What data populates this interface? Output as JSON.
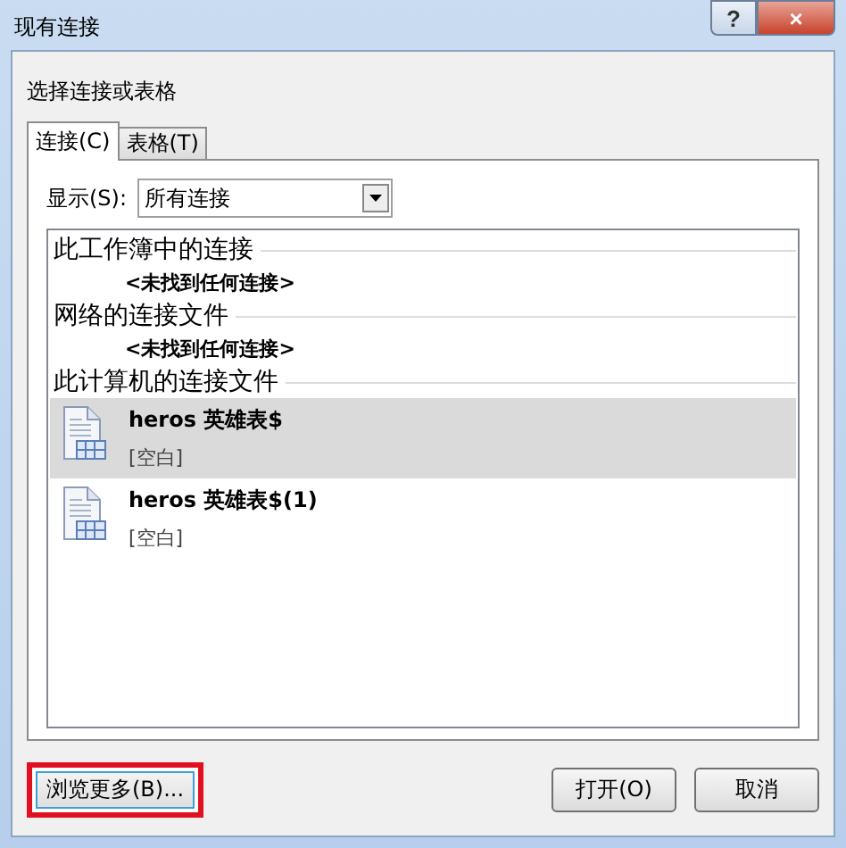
{
  "window": {
    "title": "现有连接",
    "help": "?",
    "close": "×"
  },
  "prompt": "选择连接或表格",
  "tabs": [
    {
      "label": "连接(C)",
      "selected": true
    },
    {
      "label": "表格(T)",
      "selected": false
    }
  ],
  "show": {
    "label": "显示(S):",
    "value": "所有连接"
  },
  "groups": [
    {
      "title": "此工作簿中的连接",
      "empty": "<未找到任何连接>"
    },
    {
      "title": "网络的连接文件",
      "empty": "<未找到任何连接>"
    },
    {
      "title": "此计算机的连接文件",
      "items": [
        {
          "name": "heros 英雄表$",
          "desc": "[空白]",
          "selected": true
        },
        {
          "name": "heros 英雄表$(1)",
          "desc": "[空白]",
          "selected": false
        }
      ]
    }
  ],
  "buttons": [
    {
      "label": "浏览更多(B)...",
      "highlighted": true
    },
    {
      "label": "打开(O)",
      "highlighted": false
    },
    {
      "label": "取消",
      "highlighted": false
    }
  ]
}
